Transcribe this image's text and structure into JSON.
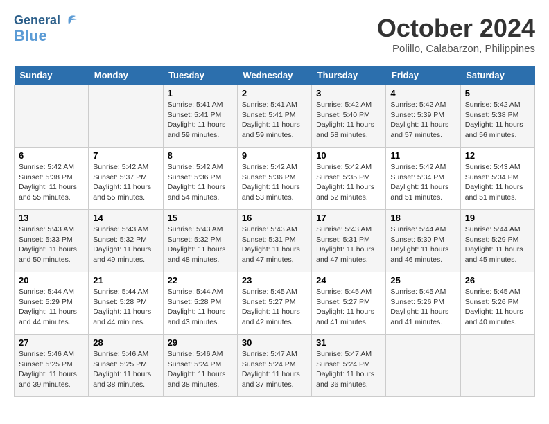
{
  "header": {
    "logo_line1": "General",
    "logo_line2": "Blue",
    "month": "October 2024",
    "location": "Polillo, Calabarzon, Philippines"
  },
  "weekdays": [
    "Sunday",
    "Monday",
    "Tuesday",
    "Wednesday",
    "Thursday",
    "Friday",
    "Saturday"
  ],
  "weeks": [
    [
      {
        "day": "",
        "info": ""
      },
      {
        "day": "",
        "info": ""
      },
      {
        "day": "1",
        "info": "Sunrise: 5:41 AM\nSunset: 5:41 PM\nDaylight: 11 hours and 59 minutes."
      },
      {
        "day": "2",
        "info": "Sunrise: 5:41 AM\nSunset: 5:41 PM\nDaylight: 11 hours and 59 minutes."
      },
      {
        "day": "3",
        "info": "Sunrise: 5:42 AM\nSunset: 5:40 PM\nDaylight: 11 hours and 58 minutes."
      },
      {
        "day": "4",
        "info": "Sunrise: 5:42 AM\nSunset: 5:39 PM\nDaylight: 11 hours and 57 minutes."
      },
      {
        "day": "5",
        "info": "Sunrise: 5:42 AM\nSunset: 5:38 PM\nDaylight: 11 hours and 56 minutes."
      }
    ],
    [
      {
        "day": "6",
        "info": "Sunrise: 5:42 AM\nSunset: 5:38 PM\nDaylight: 11 hours and 55 minutes."
      },
      {
        "day": "7",
        "info": "Sunrise: 5:42 AM\nSunset: 5:37 PM\nDaylight: 11 hours and 55 minutes."
      },
      {
        "day": "8",
        "info": "Sunrise: 5:42 AM\nSunset: 5:36 PM\nDaylight: 11 hours and 54 minutes."
      },
      {
        "day": "9",
        "info": "Sunrise: 5:42 AM\nSunset: 5:36 PM\nDaylight: 11 hours and 53 minutes."
      },
      {
        "day": "10",
        "info": "Sunrise: 5:42 AM\nSunset: 5:35 PM\nDaylight: 11 hours and 52 minutes."
      },
      {
        "day": "11",
        "info": "Sunrise: 5:42 AM\nSunset: 5:34 PM\nDaylight: 11 hours and 51 minutes."
      },
      {
        "day": "12",
        "info": "Sunrise: 5:43 AM\nSunset: 5:34 PM\nDaylight: 11 hours and 51 minutes."
      }
    ],
    [
      {
        "day": "13",
        "info": "Sunrise: 5:43 AM\nSunset: 5:33 PM\nDaylight: 11 hours and 50 minutes."
      },
      {
        "day": "14",
        "info": "Sunrise: 5:43 AM\nSunset: 5:32 PM\nDaylight: 11 hours and 49 minutes."
      },
      {
        "day": "15",
        "info": "Sunrise: 5:43 AM\nSunset: 5:32 PM\nDaylight: 11 hours and 48 minutes."
      },
      {
        "day": "16",
        "info": "Sunrise: 5:43 AM\nSunset: 5:31 PM\nDaylight: 11 hours and 47 minutes."
      },
      {
        "day": "17",
        "info": "Sunrise: 5:43 AM\nSunset: 5:31 PM\nDaylight: 11 hours and 47 minutes."
      },
      {
        "day": "18",
        "info": "Sunrise: 5:44 AM\nSunset: 5:30 PM\nDaylight: 11 hours and 46 minutes."
      },
      {
        "day": "19",
        "info": "Sunrise: 5:44 AM\nSunset: 5:29 PM\nDaylight: 11 hours and 45 minutes."
      }
    ],
    [
      {
        "day": "20",
        "info": "Sunrise: 5:44 AM\nSunset: 5:29 PM\nDaylight: 11 hours and 44 minutes."
      },
      {
        "day": "21",
        "info": "Sunrise: 5:44 AM\nSunset: 5:28 PM\nDaylight: 11 hours and 44 minutes."
      },
      {
        "day": "22",
        "info": "Sunrise: 5:44 AM\nSunset: 5:28 PM\nDaylight: 11 hours and 43 minutes."
      },
      {
        "day": "23",
        "info": "Sunrise: 5:45 AM\nSunset: 5:27 PM\nDaylight: 11 hours and 42 minutes."
      },
      {
        "day": "24",
        "info": "Sunrise: 5:45 AM\nSunset: 5:27 PM\nDaylight: 11 hours and 41 minutes."
      },
      {
        "day": "25",
        "info": "Sunrise: 5:45 AM\nSunset: 5:26 PM\nDaylight: 11 hours and 41 minutes."
      },
      {
        "day": "26",
        "info": "Sunrise: 5:45 AM\nSunset: 5:26 PM\nDaylight: 11 hours and 40 minutes."
      }
    ],
    [
      {
        "day": "27",
        "info": "Sunrise: 5:46 AM\nSunset: 5:25 PM\nDaylight: 11 hours and 39 minutes."
      },
      {
        "day": "28",
        "info": "Sunrise: 5:46 AM\nSunset: 5:25 PM\nDaylight: 11 hours and 38 minutes."
      },
      {
        "day": "29",
        "info": "Sunrise: 5:46 AM\nSunset: 5:24 PM\nDaylight: 11 hours and 38 minutes."
      },
      {
        "day": "30",
        "info": "Sunrise: 5:47 AM\nSunset: 5:24 PM\nDaylight: 11 hours and 37 minutes."
      },
      {
        "day": "31",
        "info": "Sunrise: 5:47 AM\nSunset: 5:24 PM\nDaylight: 11 hours and 36 minutes."
      },
      {
        "day": "",
        "info": ""
      },
      {
        "day": "",
        "info": ""
      }
    ]
  ]
}
